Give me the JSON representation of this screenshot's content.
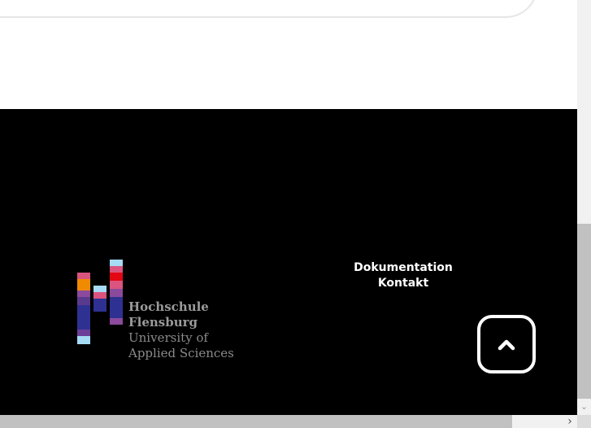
{
  "footer": {
    "logo": {
      "line1": "Hochschule",
      "line2": "Flensburg",
      "line3": "University of",
      "line4": "Applied Sciences"
    },
    "links": [
      "Dokumentation",
      "Kontakt"
    ],
    "scroll_top_icon": "chevron-up-icon"
  },
  "scrollbars": {
    "down_arrow_icon": "chevron-down-icon",
    "right_arrow_icon": "chevron-right-icon"
  },
  "colors": {
    "footer_background": "#000000",
    "logo_blue": "#2e3192",
    "logo_red": "#e30613",
    "logo_orange": "#f08a00",
    "logo_pink": "#d9547f",
    "logo_purple": "#8b4a9b",
    "logo_light_blue": "#a6dbf5"
  }
}
